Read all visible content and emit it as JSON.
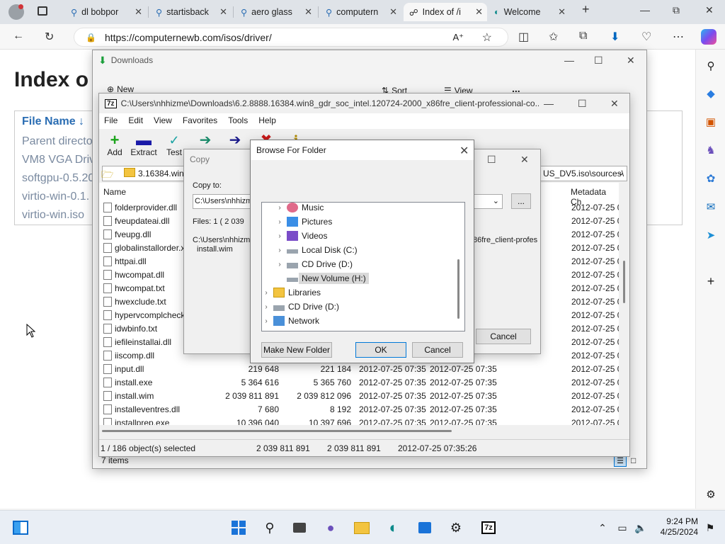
{
  "browser": {
    "tabs": [
      {
        "label": "dl bobpor",
        "icon": "search-icon"
      },
      {
        "label": "startisback",
        "icon": "search-icon"
      },
      {
        "label": "aero glass",
        "icon": "search-icon"
      },
      {
        "label": "computern",
        "icon": "search-icon"
      },
      {
        "label": "Index of /i",
        "icon": "site-icon",
        "active": true
      },
      {
        "label": "Welcome",
        "icon": "edge-icon"
      }
    ],
    "url": "https://computernewb.com/isos/driver/"
  },
  "webpage": {
    "title": "Index o",
    "column_header": "File Name ↓",
    "rows": [
      "Parent directo",
      "VM8 VGA Driv",
      "softgpu-0.5.20",
      "virtio-win-0.1.",
      "virtio-win.iso"
    ]
  },
  "downloads": {
    "title": "Downloads",
    "toolbar": {
      "new": "New",
      "sort": "Sort",
      "view": "View",
      "more": "..."
    },
    "status": "7 items"
  },
  "sevenzip": {
    "title": "C:\\Users\\nhhizme\\Downloads\\6.2.8888.16384.win8_gdr_soc_intel.120724-2000_x86fre_client-professional-co...",
    "menu": [
      "File",
      "Edit",
      "View",
      "Favorites",
      "Tools",
      "Help"
    ],
    "tools": [
      {
        "label": "Add",
        "icon": "add-icon"
      },
      {
        "label": "Extract",
        "icon": "extract-icon"
      },
      {
        "label": "Test",
        "icon": "test-icon"
      },
      {
        "label": "",
        "icon": "copy-icon"
      },
      {
        "label": "",
        "icon": "move-icon"
      },
      {
        "label": "",
        "icon": "delete-icon"
      },
      {
        "label": "",
        "icon": "info-icon"
      }
    ],
    "path_left": "3.16384.win8",
    "path_right": "US_DV5.iso\\sources\\",
    "columns": {
      "name": "Name",
      "metadata": "Metadata Ch"
    },
    "files": [
      {
        "name": "folderprovider.dll",
        "meta": "2012-07-25 0"
      },
      {
        "name": "fveupdateai.dll",
        "meta": "2012-07-25 0"
      },
      {
        "name": "fveupg.dll",
        "meta": "2012-07-25 0"
      },
      {
        "name": "globalinstallorder.x",
        "meta": "2012-07-25 0"
      },
      {
        "name": "httpai.dll",
        "meta": "2012-07-25 0"
      },
      {
        "name": "hwcompat.dll",
        "meta": "2012-07-25 0"
      },
      {
        "name": "hwcompat.txt",
        "meta": "2012-07-25 0"
      },
      {
        "name": "hwexclude.txt",
        "meta": "2012-07-25 0"
      },
      {
        "name": "hypervcomplcheck",
        "meta": "2012-07-25 0"
      },
      {
        "name": "idwbinfo.txt",
        "meta": "2012-07-25 0"
      },
      {
        "name": "iefileinstallai.dll",
        "meta": "2012-07-25 0"
      },
      {
        "name": "iiscomp.dll",
        "size": "",
        "packed": "",
        "mod": "",
        "created": "07:35",
        "meta": "2012-07-25 0"
      },
      {
        "name": "input.dll",
        "size": "219 648",
        "packed": "221 184",
        "mod": "2012-07-25 07:35",
        "created": "2012-07-25 07:35",
        "meta": "2012-07-25 0"
      },
      {
        "name": "install.exe",
        "size": "5 364 616",
        "packed": "5 365 760",
        "mod": "2012-07-25 07:35",
        "created": "2012-07-25 07:35",
        "meta": "2012-07-25 0"
      },
      {
        "name": "install.wim",
        "size": "2 039 811 891",
        "packed": "2 039 812 096",
        "mod": "2012-07-25 07:35",
        "created": "2012-07-25 07:35",
        "meta": "2012-07-25 0"
      },
      {
        "name": "installeventres.dll",
        "size": "7 680",
        "packed": "8 192",
        "mod": "2012-07-25 07:35",
        "created": "2012-07-25 07:35",
        "meta": "2012-07-25 0"
      },
      {
        "name": "installprep.exe",
        "size": "10 396 040",
        "packed": "10 397 696",
        "mod": "2012-07-25 07:35",
        "created": "2012-07-25 07:35",
        "meta": "2012-07-25 0"
      }
    ],
    "status": {
      "selected": "1 / 186 object(s) selected",
      "size": "2 039 811 891",
      "packed": "2 039 811 891",
      "date": "2012-07-25 07:35:26"
    }
  },
  "copy_dialog": {
    "title": "Copy",
    "copy_to_label": "Copy to:",
    "copy_to_value": "C:\\Users\\nhhizm",
    "files_info": "Files: 1    ( 2 039",
    "path_line1": "C:\\Users\\nhhizme",
    "path_line2": "install.wim",
    "right_path": "86fre_client-profes",
    "browse_label": "...",
    "cancel_label": "Cancel"
  },
  "browse_folder": {
    "title": "Browse For Folder",
    "tree": [
      {
        "label": "Music",
        "icon": "music-icon",
        "level": 2,
        "expander": "›"
      },
      {
        "label": "Pictures",
        "icon": "pictures-icon",
        "level": 2,
        "expander": "›"
      },
      {
        "label": "Videos",
        "icon": "videos-icon",
        "level": 2,
        "expander": "›"
      },
      {
        "label": "Local Disk (C:)",
        "icon": "drive-icon",
        "level": 2,
        "expander": "›"
      },
      {
        "label": "CD Drive (D:)",
        "icon": "cd-icon",
        "level": 2,
        "expander": "›"
      },
      {
        "label": "New Volume (H:)",
        "icon": "drive-icon",
        "level": 2,
        "expander": "",
        "selected": true
      },
      {
        "label": "Libraries",
        "icon": "folder-icon",
        "level": 1,
        "expander": "›"
      },
      {
        "label": "CD Drive (D:)",
        "icon": "cd-icon",
        "level": 1,
        "expander": "›"
      },
      {
        "label": "Network",
        "icon": "network-icon",
        "level": 1,
        "expander": "›"
      }
    ],
    "make_new_folder": "Make New Folder",
    "ok": "OK",
    "cancel": "Cancel"
  },
  "taskbar": {
    "time": "9:24 PM",
    "date": "4/25/2024"
  },
  "colors": {
    "accent": "#0078d7",
    "selection": "#cce8ff",
    "page_link": "#2a6db3"
  }
}
